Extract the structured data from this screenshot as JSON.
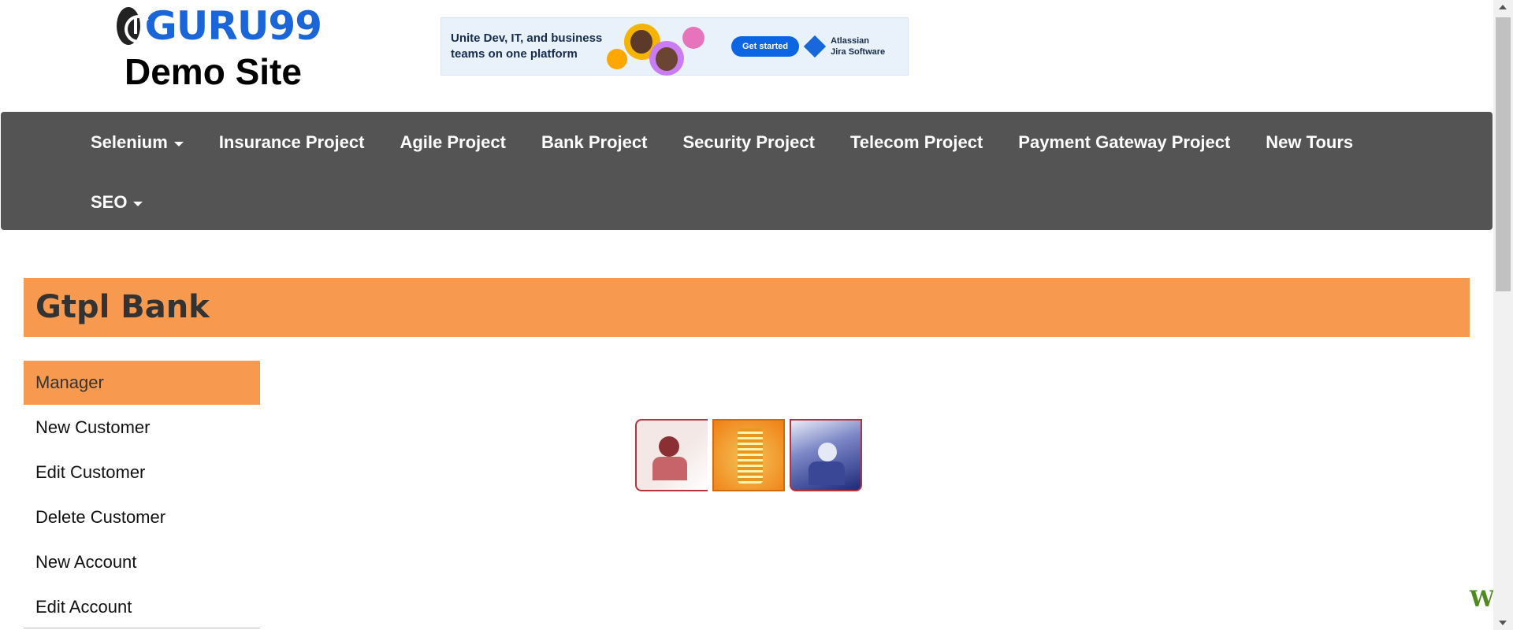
{
  "logo": {
    "brand": "GURU99",
    "subtitle": "Demo Site"
  },
  "ad": {
    "headline": "Unite Dev, IT, and business teams on one platform",
    "cta": "Get started",
    "brand_line1": "Atlassian",
    "brand_line2": "Jira Software"
  },
  "nav": {
    "row1": [
      {
        "label": "Selenium",
        "dropdown": true
      },
      {
        "label": "Insurance Project"
      },
      {
        "label": "Agile Project"
      },
      {
        "label": "Bank Project"
      },
      {
        "label": "Security Project"
      },
      {
        "label": "Telecom Project"
      },
      {
        "label": "Payment Gateway Project"
      },
      {
        "label": "New Tours"
      }
    ],
    "row2": [
      {
        "label": "SEO",
        "dropdown": true
      }
    ]
  },
  "bank": {
    "title": "Gtpl Bank"
  },
  "sidebar": {
    "items": [
      {
        "label": "Manager",
        "active": true
      },
      {
        "label": "New Customer"
      },
      {
        "label": "Edit Customer"
      },
      {
        "label": "Delete Customer"
      },
      {
        "label": "New Account"
      },
      {
        "label": "Edit Account"
      }
    ]
  },
  "corner": {
    "text": "W"
  },
  "colors": {
    "accent": "#f79a50",
    "navbar": "#545454",
    "brand": "#1a66d9"
  }
}
